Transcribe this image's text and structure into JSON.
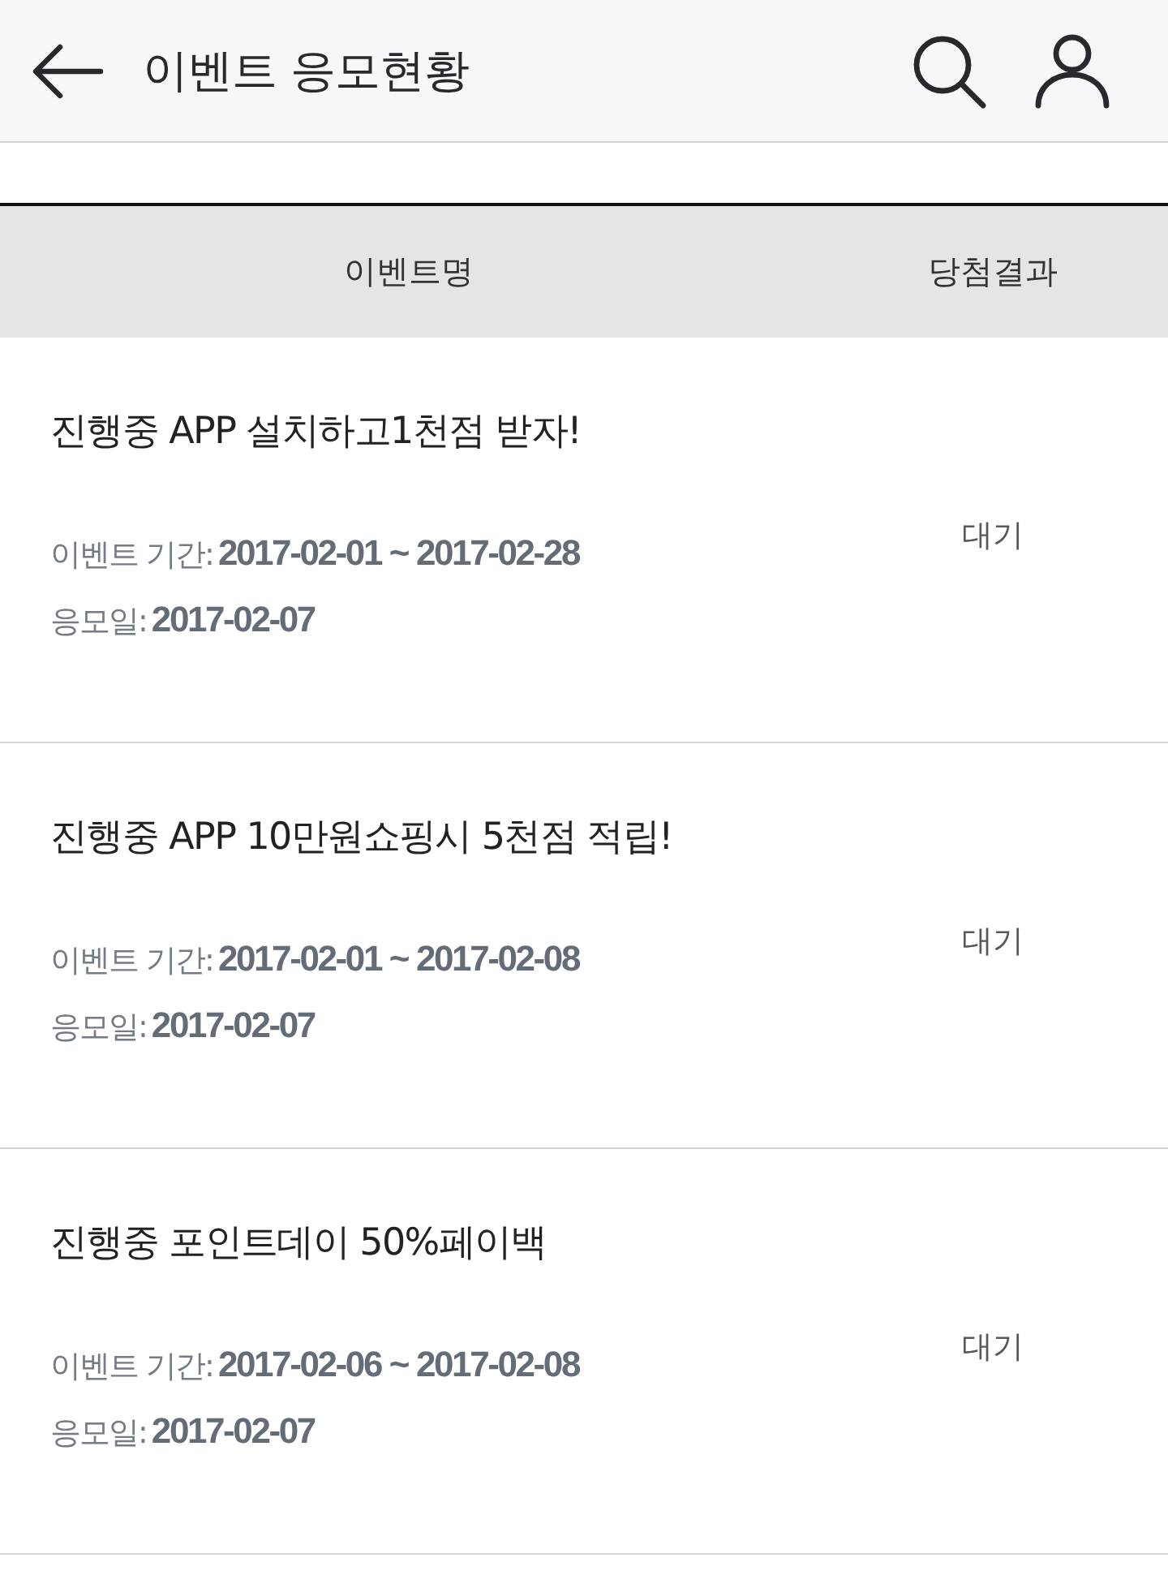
{
  "header": {
    "title": "이벤트 응모현황"
  },
  "table": {
    "columns": [
      "이벤트명",
      "당첨결과"
    ],
    "rows": [
      {
        "title": "진행중 APP 설치하고1천점 받자!",
        "period_label": "이벤트 기간:",
        "period": "2017-02-01 ~ 2017-02-28",
        "date_label": "응모일:",
        "date": "2017-02-07",
        "result": "대기"
      },
      {
        "title": "진행중 APP 10만원쇼핑시 5천점 적립!",
        "period_label": "이벤트 기간:",
        "period": "2017-02-01 ~ 2017-02-08",
        "date_label": "응모일:",
        "date": "2017-02-07",
        "result": "대기"
      },
      {
        "title": "진행중 포인트데이 50%페이백",
        "period_label": "이벤트 기간:",
        "period": "2017-02-06 ~ 2017-02-08",
        "date_label": "응모일:",
        "date": "2017-02-07",
        "result": "대기"
      }
    ]
  }
}
